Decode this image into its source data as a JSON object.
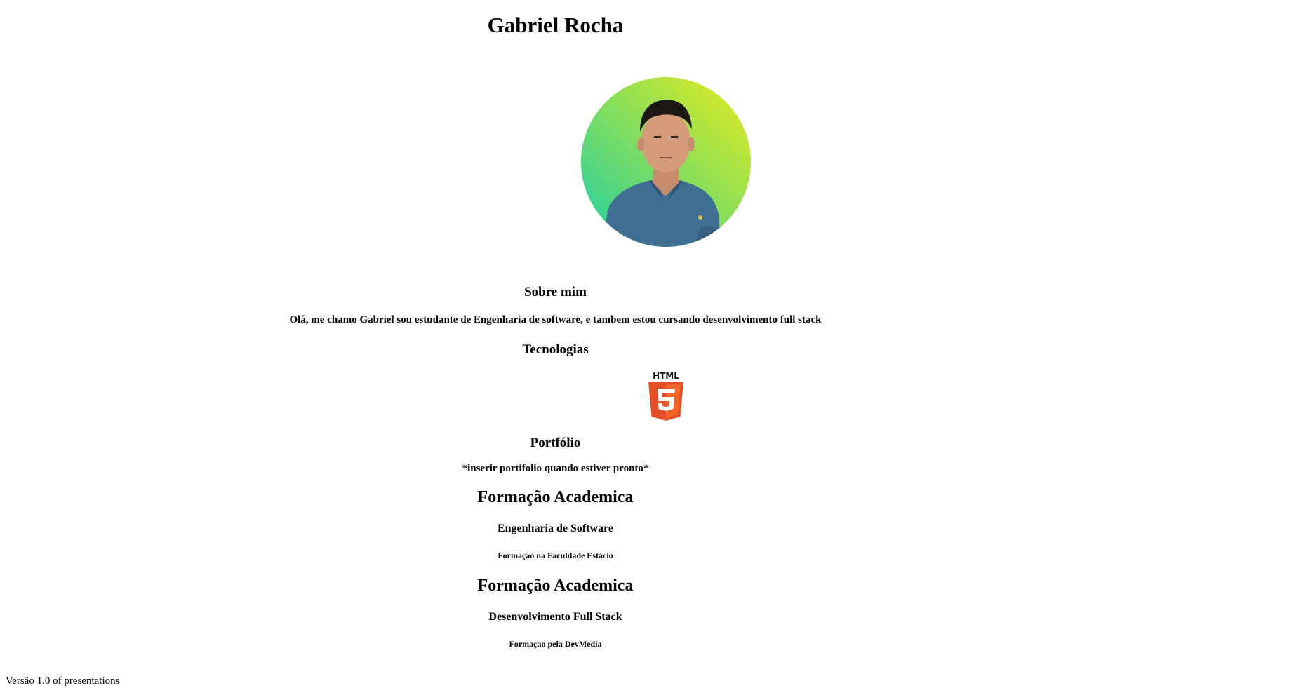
{
  "header": {
    "name": "Gabriel Rocha"
  },
  "about": {
    "title": "Sobre mim",
    "text": "Olá, me chamo Gabriel sou estudante de Engenharia de software, e tambem estou cursando desenvolvimento full stack"
  },
  "technologies": {
    "title": "Tecnologias",
    "items": [
      {
        "label": "HTML",
        "icon": "html5-logo-icon",
        "color": "#e44d26"
      }
    ]
  },
  "portfolio": {
    "title": "Portfólio",
    "text": "*inserir portifolio quando estiver pronto*"
  },
  "education": [
    {
      "title": "Formação Academica",
      "course": "Engenharia de Software",
      "detail": "Formaçao na Faculdade Estácio"
    },
    {
      "title": "Formação Academica",
      "course": "Desenvolvimento Full Stack",
      "detail": "Formaçao pela DevMedia"
    }
  ],
  "footer": {
    "version": "Versão 1.0 of presentations"
  },
  "colors": {
    "avatar_gradient_start": "#1ecfa8",
    "avatar_gradient_end": "#e8ec1c",
    "shirt": "#3f6f92"
  }
}
